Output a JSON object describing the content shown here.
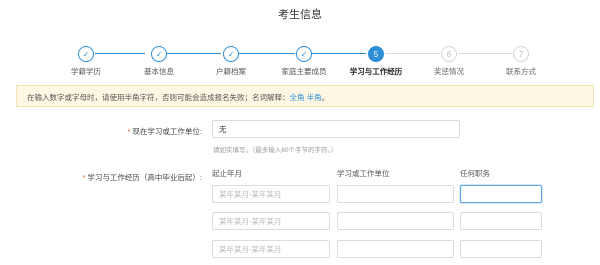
{
  "page": {
    "title": "考生信息"
  },
  "steps": [
    {
      "label": "学籍学历",
      "state": "done",
      "mark": "✓"
    },
    {
      "label": "基本信息",
      "state": "done",
      "mark": "✓"
    },
    {
      "label": "户籍档案",
      "state": "done",
      "mark": "✓"
    },
    {
      "label": "家庭主要成员",
      "state": "done",
      "mark": "✓"
    },
    {
      "label": "学习与工作经历",
      "state": "current",
      "mark": "5"
    },
    {
      "label": "奖惩情况",
      "state": "todo",
      "mark": "6"
    },
    {
      "label": "联系方式",
      "state": "todo",
      "mark": "7"
    }
  ],
  "notice": {
    "text": "在输入数字或字母时，请使用半角字符，否则可能会造成报名失败；名词解释：",
    "link1": "全角",
    "link2": "半角",
    "end": "。"
  },
  "current_unit": {
    "label": "现在学习或工作单位:",
    "value": "无",
    "hint": "请如实填写。（最多输入60个字节的字符。）"
  },
  "history": {
    "label": "学习与工作经历（高中毕业后起）:",
    "columns": {
      "period": "起止年月",
      "unit": "学习或工作单位",
      "position": "任何职务"
    },
    "rows": [
      {
        "period_placeholder": "某年某月-某年某月",
        "unit": "",
        "position": ""
      },
      {
        "period_placeholder": "某年某月-某年某月",
        "unit": "",
        "position": ""
      },
      {
        "period_placeholder": "某年某月-某年某月",
        "unit": "",
        "position": ""
      }
    ]
  },
  "colors": {
    "accent": "#2e8fd8",
    "required": "#e2552b",
    "notice_bg": "#fdf7e3"
  }
}
